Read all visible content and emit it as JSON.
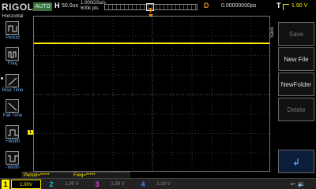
{
  "header": {
    "brand": "RIGOL",
    "run_state": "AUTO",
    "horizontal_label": "H",
    "timebase": "50.0us",
    "sample_rate": "1.000GSa/s",
    "memory_depth": "600k pts",
    "delay_label": "D",
    "delay_value": "0.00000000ps",
    "trigger_label": "T",
    "trigger_level": "1.90 V"
  },
  "left_panel": {
    "title": "Horizontal",
    "items": [
      {
        "label": "Period",
        "icon": "period-icon"
      },
      {
        "label": "Freq",
        "icon": "frequency-icon"
      },
      {
        "label": "Rise Time",
        "icon": "rise-time-icon"
      },
      {
        "label": "Fall Time",
        "icon": "fall-time-icon"
      },
      {
        "label": "+Width",
        "icon": "positive-width-icon"
      },
      {
        "label": "-Width",
        "icon": "negative-width-icon"
      }
    ]
  },
  "waveform": {
    "channel_marker": "1",
    "trigger_marker": "T"
  },
  "measurements": {
    "period": "Period=*****",
    "freq": "Freq=*****"
  },
  "right_menu": {
    "title": "Save",
    "keys": [
      {
        "label": "Save",
        "enabled": false
      },
      {
        "label": "New File",
        "enabled": true
      },
      {
        "label": "NewFolder",
        "enabled": true
      },
      {
        "label": "Delete",
        "enabled": false
      },
      {
        "label": "",
        "enabled": true
      }
    ]
  },
  "channels": [
    {
      "num": "1",
      "scale": "1.00V",
      "color": "#ffee00",
      "active": true
    },
    {
      "num": "2",
      "scale": "1.00 V",
      "color": "#1ec8c8",
      "active": false
    },
    {
      "num": "3",
      "scale": "1.00 V",
      "color": "#e040e0",
      "active": false
    },
    {
      "num": "4",
      "scale": "1.00 V",
      "color": "#3b8bff",
      "active": false
    }
  ],
  "colors": {
    "trace": "#ffee00",
    "trigger": "#f08a1c",
    "accent_blue": "#6fb3ff"
  }
}
